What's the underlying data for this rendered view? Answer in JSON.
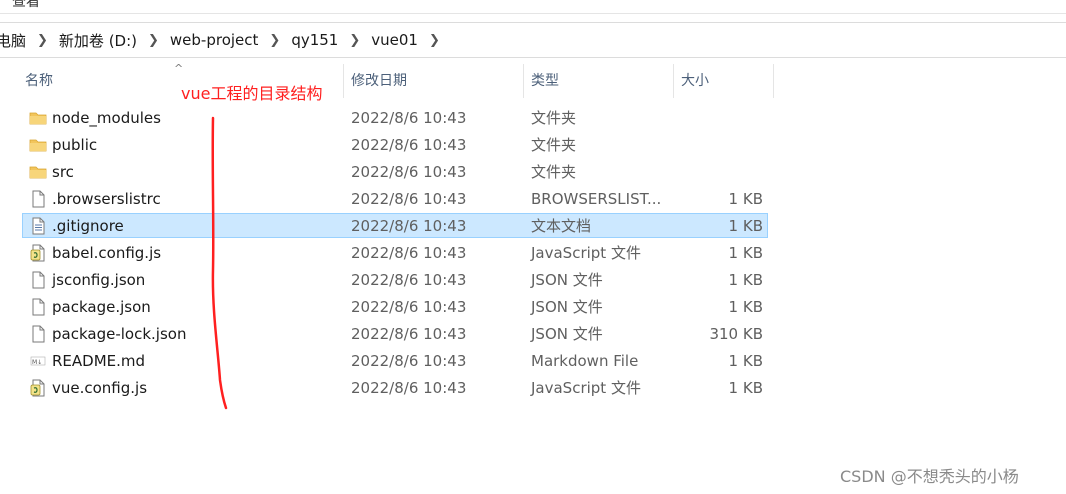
{
  "menu": {
    "view_label": "查看"
  },
  "breadcrumb": {
    "items": [
      "电脑",
      "新加卷 (D:)",
      "web-project",
      "qy151",
      "vue01"
    ]
  },
  "columns": {
    "name": "名称",
    "date": "修改日期",
    "type": "类型",
    "size": "大小"
  },
  "files": [
    {
      "name": "node_modules",
      "date": "2022/8/6 10:43",
      "type": "文件夹",
      "size": "",
      "icon": "folder-icon"
    },
    {
      "name": "public",
      "date": "2022/8/6 10:43",
      "type": "文件夹",
      "size": "",
      "icon": "folder-icon"
    },
    {
      "name": "src",
      "date": "2022/8/6 10:43",
      "type": "文件夹",
      "size": "",
      "icon": "folder-icon"
    },
    {
      "name": ".browserslistrc",
      "date": "2022/8/6 10:43",
      "type": "BROWSERSLIST...",
      "size": "1 KB",
      "icon": "file-icon"
    },
    {
      "name": ".gitignore",
      "date": "2022/8/6 10:43",
      "type": "文本文档",
      "size": "1 KB",
      "icon": "text-file-icon"
    },
    {
      "name": "babel.config.js",
      "date": "2022/8/6 10:43",
      "type": "JavaScript 文件",
      "size": "1 KB",
      "icon": "script-file-icon"
    },
    {
      "name": "jsconfig.json",
      "date": "2022/8/6 10:43",
      "type": "JSON 文件",
      "size": "1 KB",
      "icon": "file-icon"
    },
    {
      "name": "package.json",
      "date": "2022/8/6 10:43",
      "type": "JSON 文件",
      "size": "1 KB",
      "icon": "file-icon"
    },
    {
      "name": "package-lock.json",
      "date": "2022/8/6 10:43",
      "type": "JSON 文件",
      "size": "310 KB",
      "icon": "file-icon"
    },
    {
      "name": "README.md",
      "date": "2022/8/6 10:43",
      "type": "Markdown File",
      "size": "1 KB",
      "icon": "markdown-file-icon"
    },
    {
      "name": "vue.config.js",
      "date": "2022/8/6 10:43",
      "type": "JavaScript 文件",
      "size": "1 KB",
      "icon": "script-file-icon"
    }
  ],
  "selected_index": 4,
  "annotation": {
    "text": "vue工程的目录结构",
    "color": "#ff2020"
  },
  "watermark": "CSDN @不想秃头的小杨",
  "colors": {
    "selection_bg": "#cce8ff",
    "selection_border": "#99d1ff",
    "folder": "#f2c55c",
    "header_text": "#4c607a"
  }
}
